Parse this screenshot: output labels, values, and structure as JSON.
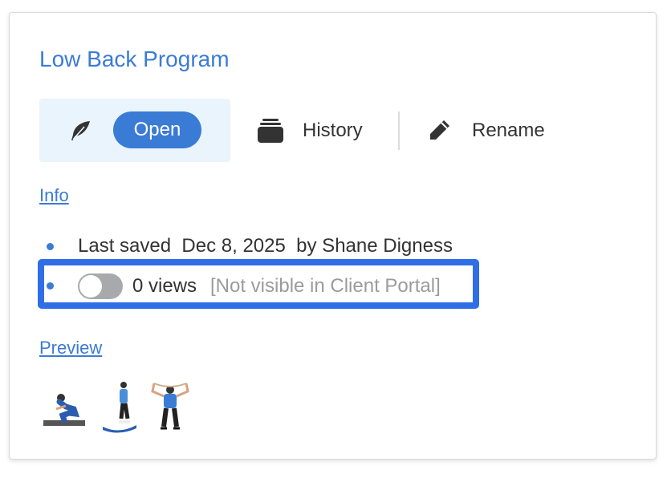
{
  "card": {
    "title": "Low Back Program",
    "actions": {
      "open_label": "Open",
      "history_label": "History",
      "rename_label": "Rename"
    },
    "info_link": "Info",
    "info": {
      "last_saved": "Last saved  Dec 8, 2025  by Shane Digness",
      "views": "0 views",
      "portal_status": "[Not visible in Client Portal]"
    },
    "preview_link": "Preview",
    "thumbnails": [
      "squat-exercise",
      "lunge-exercise",
      "band-pull-exercise"
    ]
  },
  "colors": {
    "accent": "#3a7bd5",
    "highlight": "#2f6ee6",
    "toggle_off": "#a7a9ad"
  }
}
